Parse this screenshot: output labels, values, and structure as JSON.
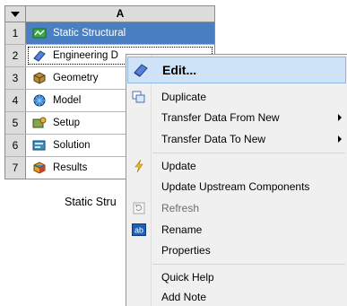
{
  "schematic": {
    "column_header": "A",
    "rows": [
      {
        "num": "1",
        "label": "Static Structural",
        "icon": "static-structural-icon"
      },
      {
        "num": "2",
        "label": "Engineering D",
        "icon": "engineering-data-icon"
      },
      {
        "num": "3",
        "label": "Geometry",
        "icon": "geometry-icon"
      },
      {
        "num": "4",
        "label": "Model",
        "icon": "model-icon"
      },
      {
        "num": "5",
        "label": "Setup",
        "icon": "setup-icon"
      },
      {
        "num": "6",
        "label": "Solution",
        "icon": "solution-icon"
      },
      {
        "num": "7",
        "label": "Results",
        "icon": "results-icon"
      }
    ],
    "caption": "Static Stru"
  },
  "context_menu": {
    "items": [
      {
        "label": "Edit...",
        "icon": "edit-book-icon"
      },
      {
        "label": "Duplicate",
        "icon": "duplicate-icon"
      },
      {
        "label": "Transfer Data From New",
        "submenu": true
      },
      {
        "label": "Transfer Data To New",
        "submenu": true
      },
      {
        "label": "Update",
        "icon": "lightning-icon"
      },
      {
        "label": "Update Upstream Components"
      },
      {
        "label": "Refresh",
        "icon": "refresh-icon",
        "disabled": true
      },
      {
        "label": "Rename",
        "icon": "rename-icon"
      },
      {
        "label": "Properties"
      },
      {
        "label": "Quick Help"
      },
      {
        "label": "Add Note"
      }
    ]
  },
  "colors": {
    "title_cell": "#4a7fc1",
    "header_bg": "#dcdcdc",
    "menu_bg": "#f0f0f0",
    "highlight": "#cfe3f8"
  }
}
